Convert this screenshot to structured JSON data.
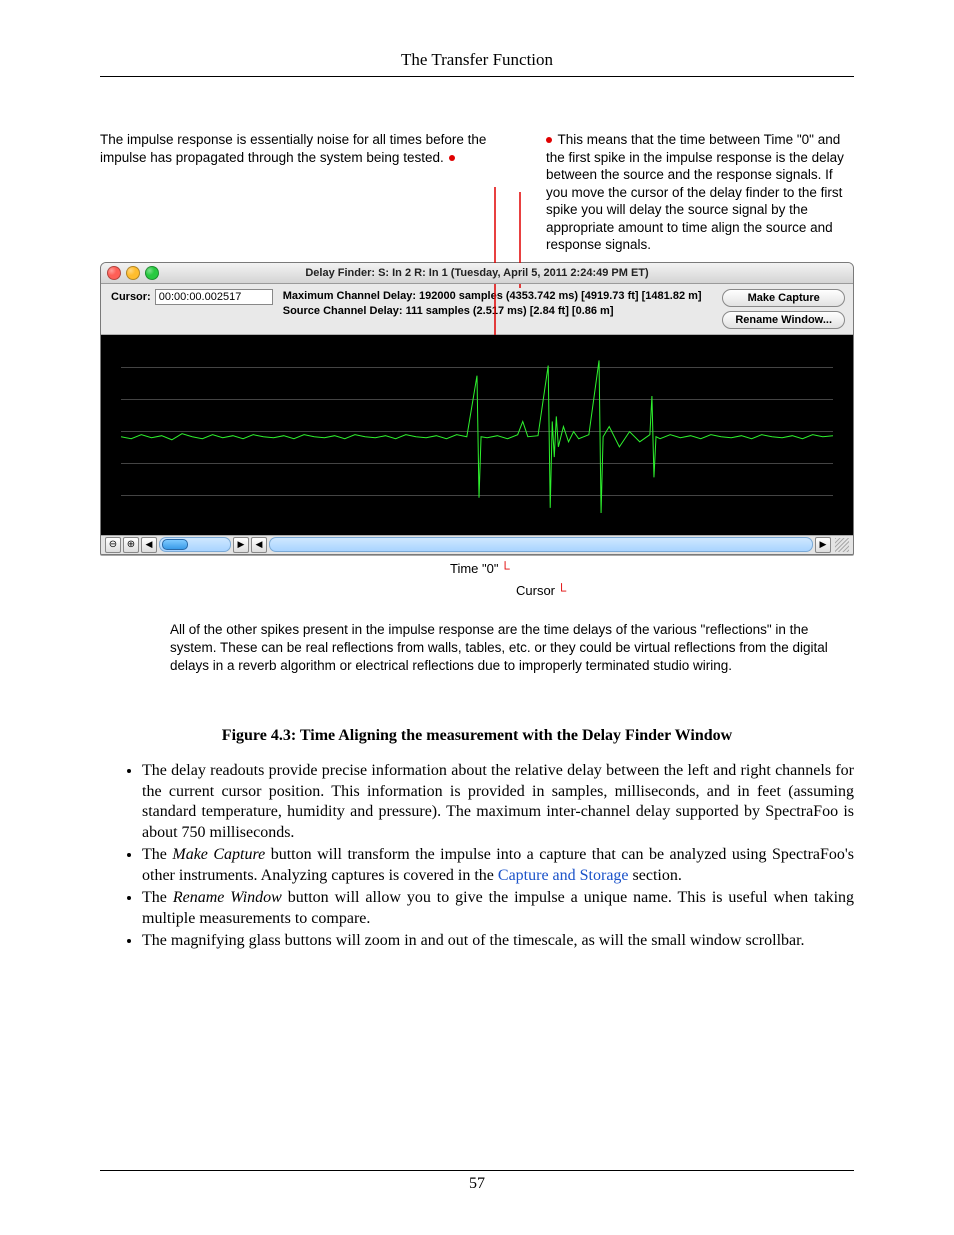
{
  "header": {
    "title": "The Transfer Function"
  },
  "annotations": {
    "top_left": "The impulse response is essentially noise for all times before the impulse has propagated through the system being tested.",
    "top_right": "This means that the time between Time \"0\" and the first spike in the impulse response is the delay between the source and the response signals. If you move the cursor of the delay finder to the first spike you will delay the source signal by the appropriate amount to time align the source and response signals.",
    "below_time0": "Time \"0\"",
    "below_cursor": "Cursor",
    "bottom": "All of the other spikes present in the impulse response are the time delays of the various \"reflections\" in the system. These can be real reflections from walls, tables, etc. or they could be virtual reflections from the digital delays in a reverb algorithm or electrical reflections due to improperly terminated studio wiring."
  },
  "window": {
    "title": "Delay Finder: S: In 2  R: In 1 (Tuesday, April 5, 2011 2:24:49 PM ET)",
    "cursor_label": "Cursor:",
    "cursor_value": "00:00:00.002517",
    "max_delay": "Maximum Channel Delay:  192000 samples (4353.742 ms) [4919.73 ft] [1481.82 m]",
    "src_delay": "Source Channel Delay:  111 samples (2.517 ms) [2.84 ft] [0.86 m]",
    "make_capture": "Make Capture",
    "rename_window": "Rename Window...",
    "zoom_in": "⊕",
    "zoom_out": "⊖",
    "arrow_left": "◀",
    "arrow_right": "▶"
  },
  "caption": "Figure 4.3: Time Aligning the measurement with the Delay Finder Window",
  "bullets": {
    "b1a": "The delay readouts provide precise information about the relative delay between the left and right channels for the current cursor position. This information is provided in samples, milliseconds, and in feet (assuming standard temperature, humidity and pressure). The maximum inter-channel delay supported by SpectraFoo is about 750 milliseconds.",
    "b2_pre": "The ",
    "b2_em": "Make Capture",
    "b2_mid": " button will transform the impulse into a capture that can be analyzed using SpectraFoo's other instruments. Analyzing captures is covered in the ",
    "b2_link": "Capture and Storage",
    "b2_post": " section.",
    "b3_pre": "The ",
    "b3_em": "Rename Window",
    "b3_post": " button will allow you to give the impulse a unique name. This is useful when taking multiple measurements to compare.",
    "b4": "The magnifying glass buttons will zoom in and out of the timescale, as will the small window scrollbar."
  },
  "page_number": "57"
}
